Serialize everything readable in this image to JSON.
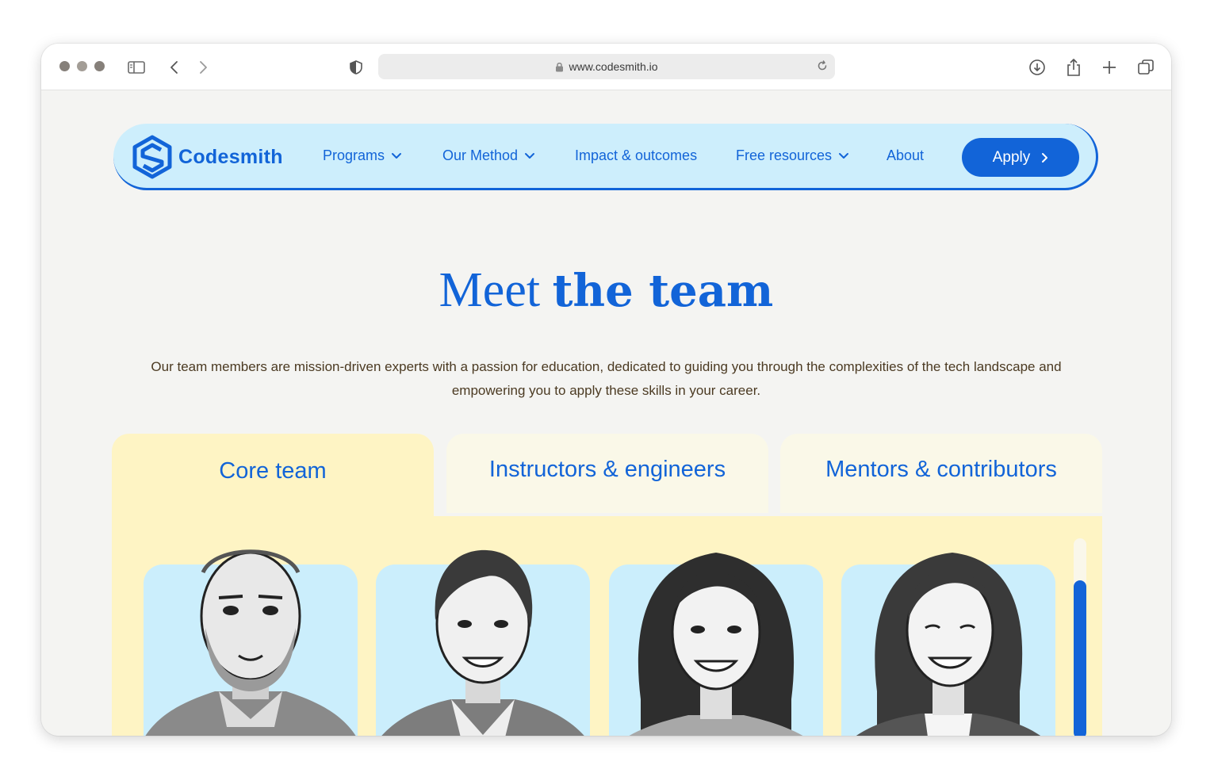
{
  "browser": {
    "url": "www.codesmith.io"
  },
  "brand": {
    "name": "Codesmith",
    "accent": "#1264d8"
  },
  "nav": {
    "programs": "Programs",
    "method": "Our Method",
    "impact": "Impact & outcomes",
    "resources": "Free resources",
    "about": "About",
    "apply": "Apply"
  },
  "hero": {
    "title_light": "Meet",
    "title_bold": "the team",
    "description": "Our team members are mission-driven experts with a passion for education, dedicated to guiding you through the complexities of the tech landscape and empowering you to apply these skills in your career."
  },
  "tabs": [
    {
      "label": "Core team",
      "active": true
    },
    {
      "label": "Instructors & engineers",
      "active": false
    },
    {
      "label": "Mentors & contributors",
      "active": false
    }
  ]
}
